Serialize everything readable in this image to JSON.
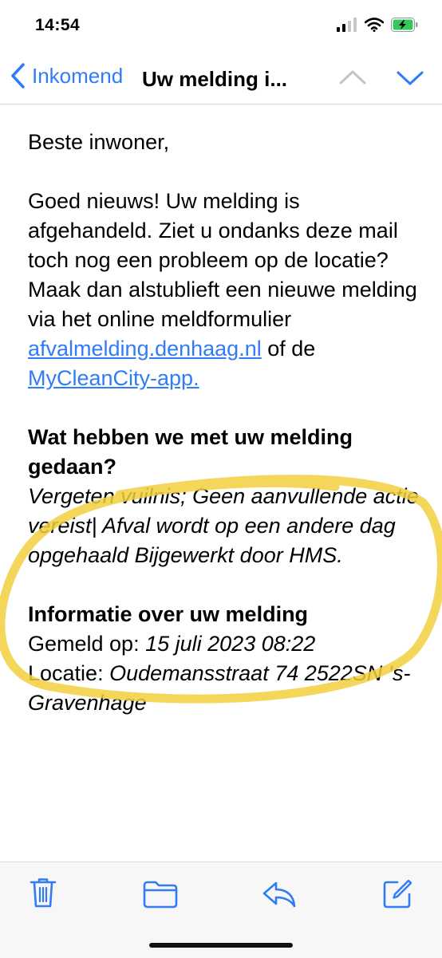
{
  "status": {
    "time": "14:54",
    "battery_color": "#34c759"
  },
  "nav": {
    "back_label": "Inkomend",
    "title": "Uw melding i..."
  },
  "email": {
    "greeting": "Beste inwoner,",
    "body_intro": "Goed nieuws! Uw melding is afgehandeld. Ziet u ondanks deze mail toch nog een probleem op de locatie? Maak dan alstublieft een nieuwe melding via het online meldformulier",
    "link1": "afvalmelding.denhaag.nl",
    "link_sep": " of de",
    "link2": "MyCleanCity-app.",
    "section1_heading": "Wat hebben we met uw melding gedaan?",
    "section1_body": "Vergeten vuilnis; Geen aanvullende actie vereist| Afval wordt op een andere dag opgehaald Bijgewerkt door HMS.",
    "section2_heading": "Informatie over uw melding",
    "reported_label": "Gemeld op:",
    "reported_value": "15 juli 2023 08:22",
    "location_label": "Locatie:",
    "location_value": "Oudemansstraat 74 2522SN 's-Gravenhage"
  },
  "colors": {
    "accent": "#2f7cf6",
    "highlight": "#f2cf3e"
  },
  "toolbar": {
    "icons": [
      "trash-icon",
      "folder-icon",
      "reply-icon",
      "compose-icon"
    ]
  }
}
